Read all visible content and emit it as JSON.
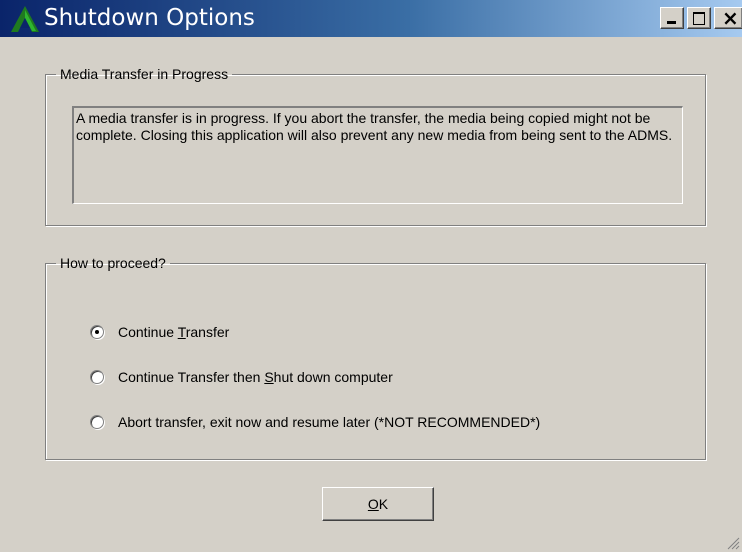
{
  "window": {
    "title": "Shutdown Options",
    "accent": "#0a246a"
  },
  "titlebar": {
    "icons": [
      "app-icon",
      "minimize-icon",
      "maximize-icon",
      "close-icon"
    ]
  },
  "media_group": {
    "legend": "Media Transfer in Progress",
    "message": "A media transfer is in progress. If you abort the transfer, the media being copied might not be complete. Closing this application will also prevent any new media from being sent to the ADMS."
  },
  "proceed_group": {
    "legend": "How to proceed?",
    "options": [
      {
        "pre": "Continue ",
        "mnemonic": "T",
        "post": "ransfer",
        "selected": true
      },
      {
        "pre": "Continue Transfer then ",
        "mnemonic": "S",
        "post": "hut down computer",
        "selected": false
      },
      {
        "pre": "Abort transfer, exit now and resume later (*NOT RECOMMENDED*)",
        "mnemonic": "",
        "post": "",
        "selected": false
      }
    ]
  },
  "ok_button": {
    "mnemonic": "O",
    "rest": "K"
  }
}
